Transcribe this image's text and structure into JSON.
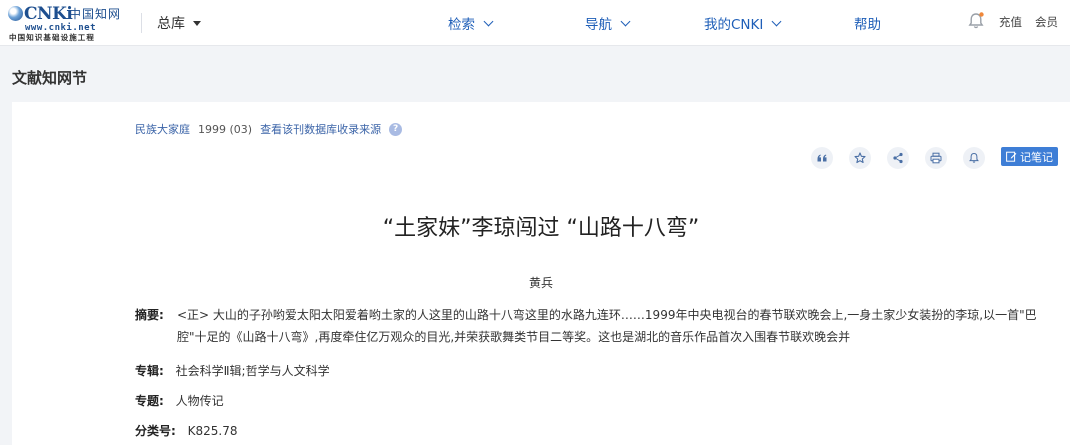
{
  "header": {
    "logo_mark": "CNKi",
    "logo_cn": "中国知网",
    "logo_url": "www.cnki.net",
    "logo_sub": "中国知识基础设施工程",
    "db_selector": "总库",
    "nav": [
      {
        "label": "检索"
      },
      {
        "label": "导航"
      },
      {
        "label": "我的CNKI"
      }
    ],
    "help": "帮助",
    "recharge": "充值",
    "member": "会员"
  },
  "section_title": "文献知网节",
  "article": {
    "journal": "民族大家庭",
    "issue": "1999 (03)",
    "source_link": "查看该刊数据库收录来源",
    "title": "“土家妹”李琼闯过 “山路十八弯”",
    "author": "黄兵",
    "abstract_label": "摘要:",
    "abstract": "<正> 大山的子孙哟爱太阳太阳爱着哟土家的人这里的山路十八弯这里的水路九连环……1999年中央电视台的春节联欢晚会上,一身土家少女装扮的李琼,以一首\"巴腔\"十足的《山路十八弯》,再度牵住亿万观众的目光,并荣获歌舞类节目二等奖。这也是湖北的音乐作品首次入围春节联欢晚会并",
    "special_label": "专辑:",
    "special": "社会科学Ⅱ辑;哲学与人文科学",
    "topic_label": "专题:",
    "topic": "人物传记",
    "class_label": "分类号:",
    "class_no": "K825.78"
  },
  "toolbar": {
    "icons": [
      "quote-icon",
      "star-icon",
      "share-icon",
      "print-icon",
      "bell-icon"
    ],
    "note_button": "记笔记"
  },
  "colors": {
    "accent": "#1f5fb8",
    "note_button": "#3e7ed6",
    "background": "#f2f4f7"
  }
}
